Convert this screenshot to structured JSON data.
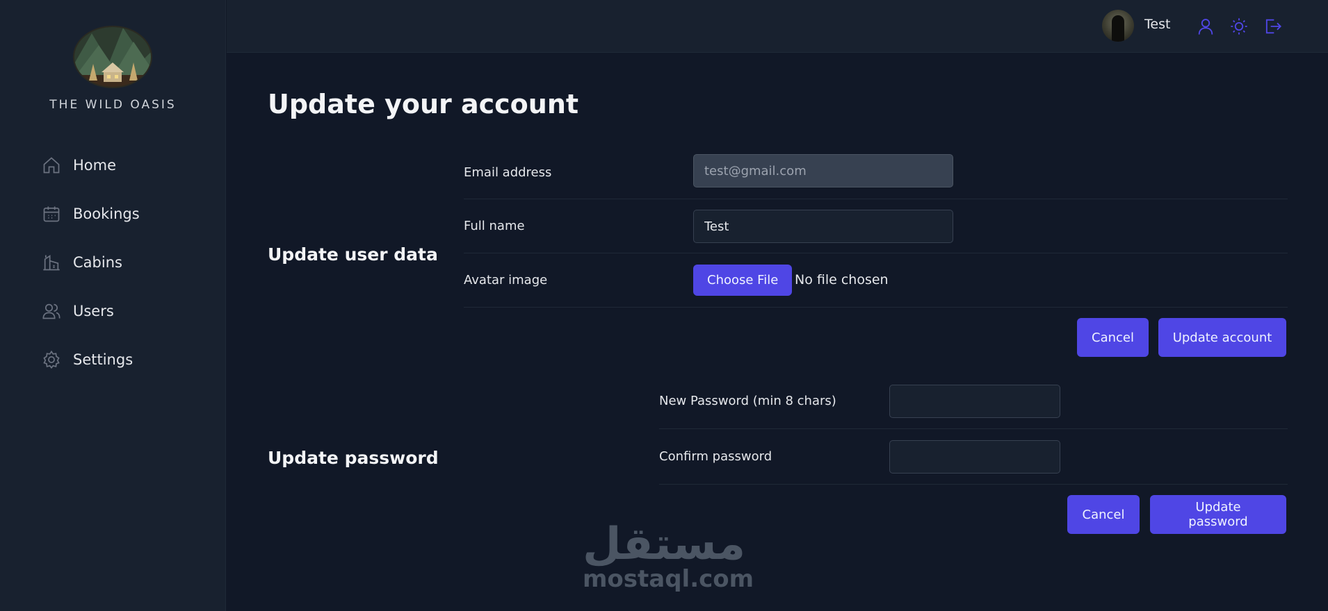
{
  "app": {
    "brand": "THE WILD OASIS"
  },
  "sidebar": {
    "items": [
      {
        "label": "Home",
        "icon": "home-icon"
      },
      {
        "label": "Bookings",
        "icon": "calendar-icon"
      },
      {
        "label": "Cabins",
        "icon": "cabin-icon"
      },
      {
        "label": "Users",
        "icon": "users-icon"
      },
      {
        "label": "Settings",
        "icon": "gear-icon"
      }
    ]
  },
  "header": {
    "user_name": "Test",
    "icons": [
      "user-icon",
      "sun-icon",
      "logout-icon"
    ]
  },
  "page": {
    "title": "Update your account"
  },
  "user_data": {
    "section_title": "Update user data",
    "email_label": "Email address",
    "email_value": "test@gmail.com",
    "fullname_label": "Full name",
    "fullname_value": "Test",
    "avatar_label": "Avatar image",
    "choose_file": "Choose File",
    "file_status": "No file chosen",
    "cancel": "Cancel",
    "submit": "Update account"
  },
  "password": {
    "section_title": "Update password",
    "new_label": "New Password (min 8 chars)",
    "new_value": "",
    "confirm_label": "Confirm password",
    "confirm_value": "",
    "cancel": "Cancel",
    "submit": "Update password"
  },
  "watermark": {
    "arabic": "مستقل",
    "latin": "mostaql.com"
  },
  "colors": {
    "accent": "#4f46e5",
    "background": "#111827",
    "panel": "#18212f",
    "border": "#374151"
  }
}
